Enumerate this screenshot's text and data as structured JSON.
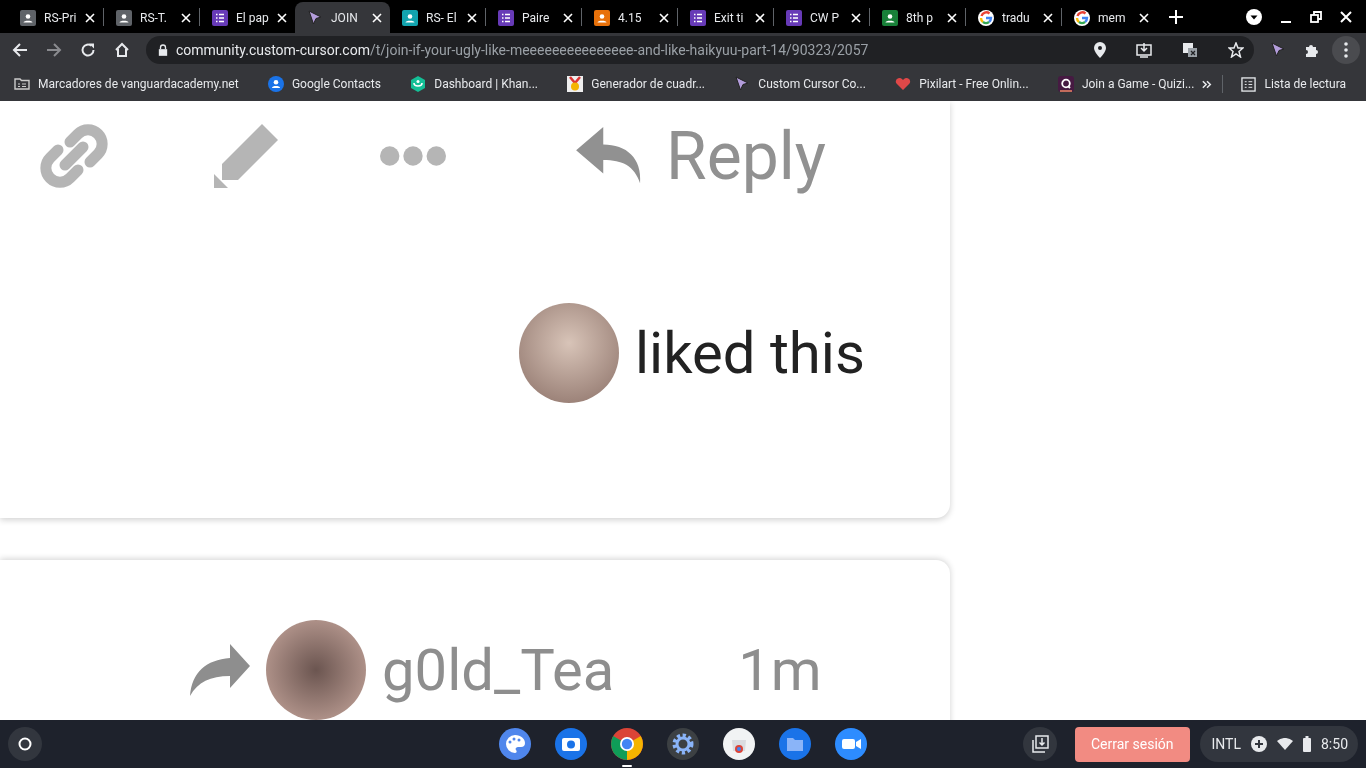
{
  "tabs": [
    {
      "title": "RS-Pri",
      "kind": "person",
      "color": "#5f6368",
      "selected": false
    },
    {
      "title": "RS-T.",
      "kind": "person",
      "color": "#5f6368",
      "selected": false
    },
    {
      "title": "El pap",
      "kind": "list",
      "color": "#673ab7",
      "selected": false
    },
    {
      "title": "JOIN",
      "kind": "cursor",
      "color": "#b39ddb",
      "selected": true
    },
    {
      "title": "RS- El",
      "kind": "person",
      "color": "#12a4af",
      "selected": false
    },
    {
      "title": "Paire",
      "kind": "list",
      "color": "#673ab7",
      "selected": false
    },
    {
      "title": "4.15",
      "kind": "person",
      "color": "#e8710a",
      "selected": false
    },
    {
      "title": "Exit ti",
      "kind": "list",
      "color": "#673ab7",
      "selected": false
    },
    {
      "title": "CW P",
      "kind": "list",
      "color": "#673ab7",
      "selected": false
    },
    {
      "title": "8th p",
      "kind": "person",
      "color": "#188038",
      "selected": false
    },
    {
      "title": "tradu",
      "kind": "ring",
      "selected": false
    },
    {
      "title": "mem",
      "kind": "ring",
      "selected": false
    }
  ],
  "address": {
    "host": "community.custom-cursor.com",
    "path": "/t/join-if-your-ugly-like-meeeeeeeeeeeeeee-and-like-haikyuu-part-14/90323/2057"
  },
  "bookmarks": [
    {
      "label": "Marcadores de vanguardacademy.net",
      "kind": "folder"
    },
    {
      "label": "Google Contacts",
      "kind": "contact"
    },
    {
      "label": "Dashboard | Khan...",
      "kind": "leaf"
    },
    {
      "label": "Generador de cuadr...",
      "kind": "medal"
    },
    {
      "label": "Custom Cursor Co...",
      "kind": "cursor"
    },
    {
      "label": "Pixilart - Free Onlin...",
      "kind": "heart"
    },
    {
      "label": "Join a Game - Quizi...",
      "kind": "quiz"
    }
  ],
  "reading_list": "Lista de lectura",
  "post": {
    "reply": "Reply",
    "liked": "liked this"
  },
  "next_post": {
    "username": "g0ld_Tea",
    "time": "1m"
  },
  "taskbar": {
    "apps": [
      {
        "kind": "palette",
        "active": false
      },
      {
        "kind": "camera",
        "active": false
      },
      {
        "kind": "browser",
        "active": true
      },
      {
        "kind": "gear",
        "active": false
      },
      {
        "kind": "store",
        "active": false
      },
      {
        "kind": "folder",
        "active": false
      },
      {
        "kind": "video",
        "active": false
      }
    ],
    "signout": "Cerrar sesión",
    "ime": "INTL",
    "clock": "8:50"
  }
}
